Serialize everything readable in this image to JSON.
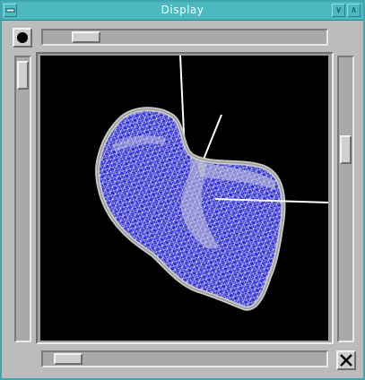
{
  "window": {
    "title": "Display",
    "titlebar_color": "#4cb8bf",
    "menu_icon": "window-menu-icon",
    "minimize_icon": "minimize-icon",
    "maximize_icon": "maximize-icon",
    "minimize_glyph": "∨",
    "maximize_glyph": "∧"
  },
  "controls": {
    "record_icon": "record-icon",
    "close_icon": "close-x-icon"
  },
  "scrollbars": {
    "top_horizontal_position": 0.1,
    "bottom_horizontal_position": 0.05,
    "left_vertical_position": 0.05,
    "right_vertical_position": 0.45
  },
  "viewport": {
    "background": "#000000",
    "mesh_fill": "#2727c4",
    "mesh_wire": "#ffffff",
    "mesh_outline": "#cfcfcf",
    "axis_color": "#ffffff"
  }
}
